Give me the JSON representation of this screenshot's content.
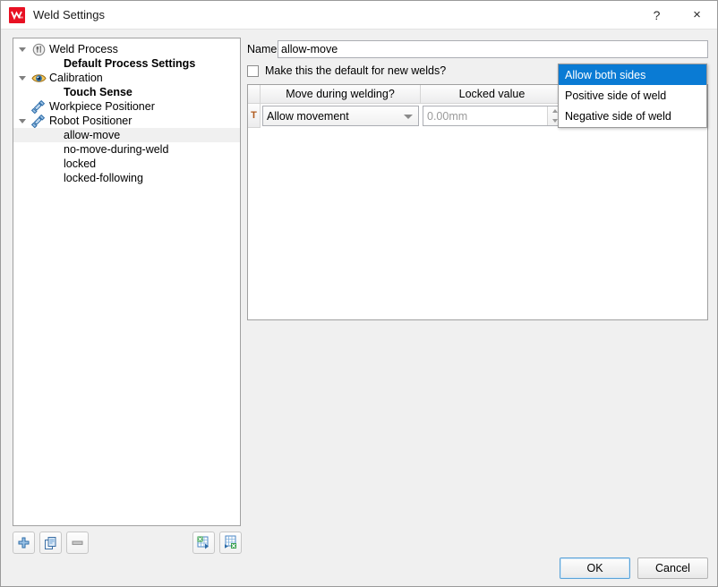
{
  "window": {
    "title": "Weld Settings",
    "app_icon": "weld-app-icon",
    "help_button": "?",
    "close_button": "×"
  },
  "tree": {
    "items": [
      {
        "label": "Weld Process",
        "icon": "weld-process-icon",
        "expander": "expanded",
        "indent": 0,
        "bold": false,
        "selected": false
      },
      {
        "label": "Default Process Settings",
        "icon": "none",
        "expander": "none",
        "indent": 1,
        "bold": true,
        "selected": false
      },
      {
        "label": "Calibration",
        "icon": "eye-icon",
        "expander": "expanded",
        "indent": 0,
        "bold": false,
        "selected": false
      },
      {
        "label": "Touch Sense",
        "icon": "none",
        "expander": "none",
        "indent": 1,
        "bold": true,
        "selected": false
      },
      {
        "label": "Workpiece Positioner",
        "icon": "positioner-icon",
        "expander": "none",
        "indent": 0,
        "bold": false,
        "selected": false
      },
      {
        "label": "Robot Positioner",
        "icon": "positioner-icon",
        "expander": "expanded",
        "indent": 0,
        "bold": false,
        "selected": false
      },
      {
        "label": "allow-move",
        "icon": "none",
        "expander": "none",
        "indent": 1,
        "bold": false,
        "selected": true
      },
      {
        "label": "no-move-during-weld",
        "icon": "none",
        "expander": "none",
        "indent": 1,
        "bold": false,
        "selected": false
      },
      {
        "label": "locked",
        "icon": "none",
        "expander": "none",
        "indent": 1,
        "bold": false,
        "selected": false
      },
      {
        "label": "locked-following",
        "icon": "none",
        "expander": "none",
        "indent": 1,
        "bold": false,
        "selected": false
      }
    ]
  },
  "tree_toolbar": {
    "add": {
      "name": "add-button",
      "icon": "plus-icon"
    },
    "duplicate": {
      "name": "duplicate-button",
      "icon": "copy-pages-icon"
    },
    "remove": {
      "name": "remove-button",
      "icon": "minus-icon"
    },
    "import": {
      "name": "import-spreadsheet-button",
      "icon": "import-excel-icon"
    },
    "export": {
      "name": "export-spreadsheet-button",
      "icon": "export-excel-icon"
    }
  },
  "details": {
    "name_label": "Name",
    "name_value": "allow-move",
    "name_placeholder": "",
    "default_checkbox_label": "Make this the default for new welds?",
    "default_checkbox_checked": false
  },
  "table": {
    "row_header": "",
    "columns": [
      "Move during welding?",
      "Locked value",
      ""
    ],
    "rows": [
      {
        "row_header": "T",
        "move_during_welding": "Allow movement",
        "locked_value": "",
        "locked_value_placeholder": "0.00mm",
        "third": ""
      }
    ]
  },
  "dropdown": {
    "open": true,
    "items": [
      {
        "label": "Allow both sides",
        "selected": true
      },
      {
        "label": "Positive side of weld",
        "selected": false
      },
      {
        "label": "Negative side of weld",
        "selected": false
      }
    ]
  },
  "footer": {
    "ok_label": "OK",
    "cancel_label": "Cancel"
  },
  "colors": {
    "accent": "#0a7bd4",
    "app_icon": "#e81123",
    "selected_row": "#f0f0f0",
    "row_header_text": "#b05a1e"
  }
}
